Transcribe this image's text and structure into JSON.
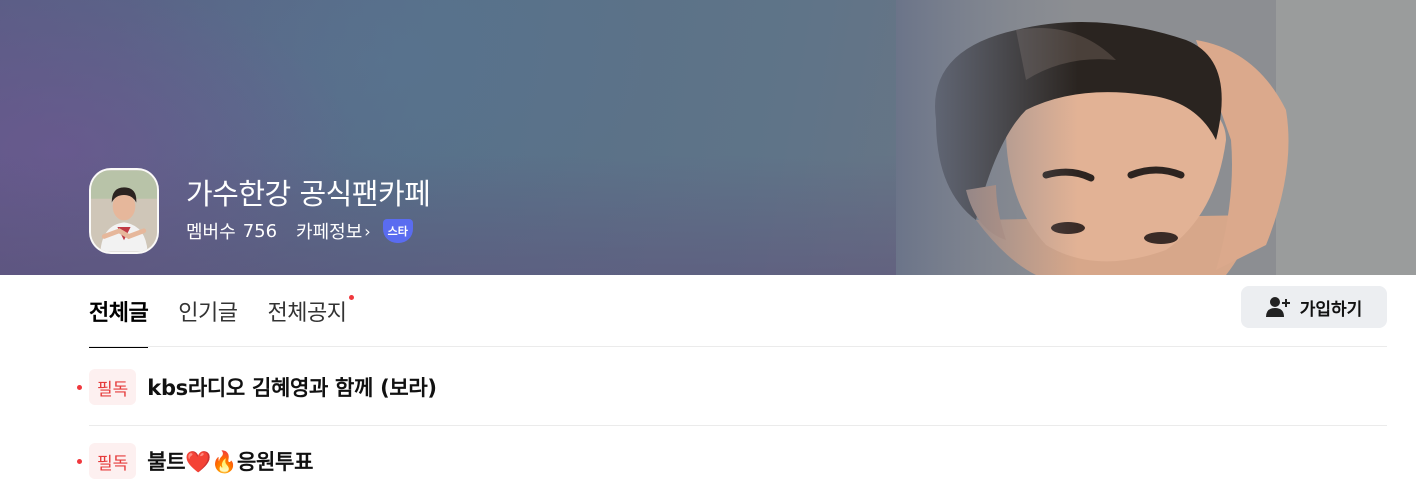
{
  "cafe": {
    "title": "가수한강 공식팬카페",
    "members_label": "멤버수",
    "members_count": "756",
    "info_link": "카페정보",
    "info_chevron": "›",
    "badge": "스타"
  },
  "tabs": [
    {
      "label": "전체글",
      "active": true
    },
    {
      "label": "인기글",
      "active": false
    },
    {
      "label": "전체공지",
      "active": false
    }
  ],
  "join_button": {
    "label": "가입하기"
  },
  "notices": [
    {
      "tag": "필독",
      "title": "kbs라디오 김혜영과 함께 (보라)"
    },
    {
      "tag": "필독",
      "title": "불트❤️🔥응원투표"
    }
  ],
  "colors": {
    "accent_red": "#f0383d",
    "badge_blue": "#5a6cf0",
    "tag_bg": "#fdf0f0"
  }
}
